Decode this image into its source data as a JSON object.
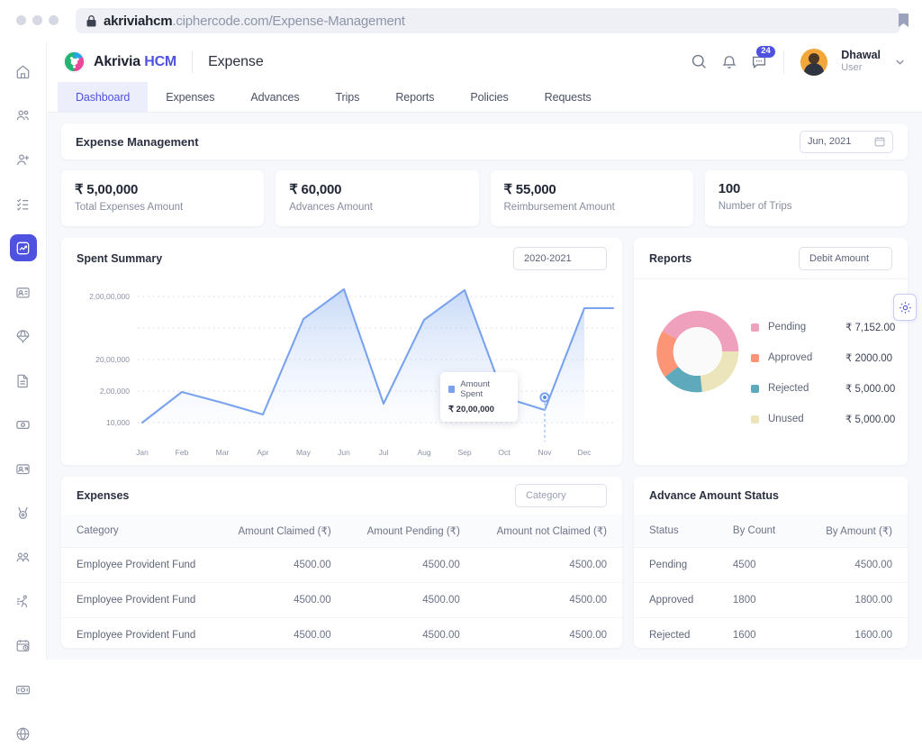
{
  "browser": {
    "url_bold": "akriviahcm",
    "url_rest": ".ciphercode.com/Expense-Management",
    "lock_icon": "lock-icon",
    "bookmark_icon": "bookmark-icon"
  },
  "rail": {
    "items": [
      {
        "name": "home-icon",
        "active": false
      },
      {
        "name": "users-icon",
        "active": false
      },
      {
        "name": "user-add-icon",
        "active": false
      },
      {
        "name": "checklist-icon",
        "active": false
      },
      {
        "name": "analytics-icon",
        "active": true
      },
      {
        "name": "id-card-icon",
        "active": false
      },
      {
        "name": "parachute-icon",
        "active": false
      },
      {
        "name": "document-icon",
        "active": false
      },
      {
        "name": "ticket-icon",
        "active": false
      },
      {
        "name": "screen-user-icon",
        "active": false
      },
      {
        "name": "medal-icon",
        "active": false
      },
      {
        "name": "team-icon",
        "active": false
      },
      {
        "name": "running-icon",
        "active": false
      },
      {
        "name": "calendar-clock-icon",
        "active": false
      },
      {
        "name": "money-icon",
        "active": false
      },
      {
        "name": "globe-icon",
        "active": false
      }
    ]
  },
  "topbar": {
    "brand_first": "Akrivia ",
    "brand_accent": "HCM",
    "section": "Expense",
    "search_icon": "search-icon",
    "bell_icon": "bell-icon",
    "chat_icon": "chat-icon",
    "chat_badge": "24",
    "user_name": "Dhawal",
    "user_role": "User",
    "chevron_icon": "chevron-down-icon"
  },
  "tabs": [
    {
      "label": "Dashboard",
      "active": true
    },
    {
      "label": "Expenses",
      "active": false
    },
    {
      "label": "Advances",
      "active": false
    },
    {
      "label": "Trips",
      "active": false
    },
    {
      "label": "Reports",
      "active": false
    },
    {
      "label": "Policies",
      "active": false
    },
    {
      "label": "Requests",
      "active": false
    }
  ],
  "management": {
    "title": "Expense Management",
    "date_value": "Jun, 2021",
    "calendar_icon": "calendar-icon"
  },
  "stats": [
    {
      "value": "₹ 5,00,000",
      "label": "Total Expenses Amount"
    },
    {
      "value": "₹ 60,000",
      "label": "Advances Amount"
    },
    {
      "value": "₹ 55,000",
      "label": "Reimbursement Amount"
    },
    {
      "value": "100",
      "label": "Number of Trips"
    }
  ],
  "spent": {
    "title": "Spent Summary",
    "year_value": "2020-2021",
    "tooltip_label": "Amount Spent",
    "tooltip_value": "₹ 20,00,000"
  },
  "reports": {
    "title": "Reports",
    "filter_value": "Debit Amount",
    "gear_icon": "gear-icon"
  },
  "expenses_table": {
    "title": "Expenses",
    "filter_value": "Category",
    "columns": [
      "Category",
      "Amount Claimed (₹)",
      "Amount Pending (₹)",
      "Amount not Claimed (₹)"
    ],
    "rows": [
      [
        "Employee Provident Fund",
        "4500.00",
        "4500.00",
        "4500.00"
      ],
      [
        "Employee Provident Fund",
        "4500.00",
        "4500.00",
        "4500.00"
      ],
      [
        "Employee Provident Fund",
        "4500.00",
        "4500.00",
        "4500.00"
      ]
    ]
  },
  "advance_table": {
    "title": "Advance Amount Status",
    "columns": [
      "Status",
      "By Count",
      "By Amount (₹)"
    ],
    "rows": [
      [
        "Pending",
        "4500",
        "4500.00"
      ],
      [
        "Approved",
        "1800",
        "1800.00"
      ],
      [
        "Rejected",
        "1600",
        "1600.00"
      ]
    ]
  },
  "colors": {
    "accent": "#4f52e0",
    "line": "#7aa3ef",
    "pending": "#efa0bd",
    "approved": "#fb9576",
    "rejected": "#5fa9bc",
    "unused": "#ece5bb"
  },
  "chart_data": [
    {
      "type": "area",
      "title": "Spent Summary",
      "series_name": "Amount Spent",
      "categories": [
        "Jan",
        "Feb",
        "Mar",
        "Apr",
        "May",
        "Jun",
        "Jul",
        "Aug",
        "Sep",
        "Oct",
        "Nov",
        "Dec"
      ],
      "values": [
        10000,
        200000,
        120000,
        60000,
        1500000,
        2000000,
        120000,
        1500000,
        2000000,
        20000,
        14000,
        1800000
      ],
      "ytick_labels": [
        "2,00,00,000",
        "20,00,000",
        "2,00,000",
        "10,000"
      ],
      "xlabel": "",
      "ylabel": "",
      "grid": true,
      "legend": "tooltip",
      "highlight_point": {
        "category": "Nov",
        "label": "Amount Spent",
        "value": "₹ 20,00,000"
      }
    },
    {
      "type": "pie",
      "title": "Reports",
      "labels": [
        "Pending",
        "Approved",
        "Rejected",
        "Unused"
      ],
      "values": [
        7152.0,
        2000.0,
        5000.0,
        5000.0
      ],
      "value_labels": [
        "₹ 7,152.00",
        "₹ 2000.00",
        "₹ 5,000.00",
        "₹ 5,000.00"
      ],
      "colors": [
        "#efa0bd",
        "#fb9576",
        "#5fa9bc",
        "#ece5bb"
      ],
      "donut": true,
      "legend": "right"
    }
  ]
}
